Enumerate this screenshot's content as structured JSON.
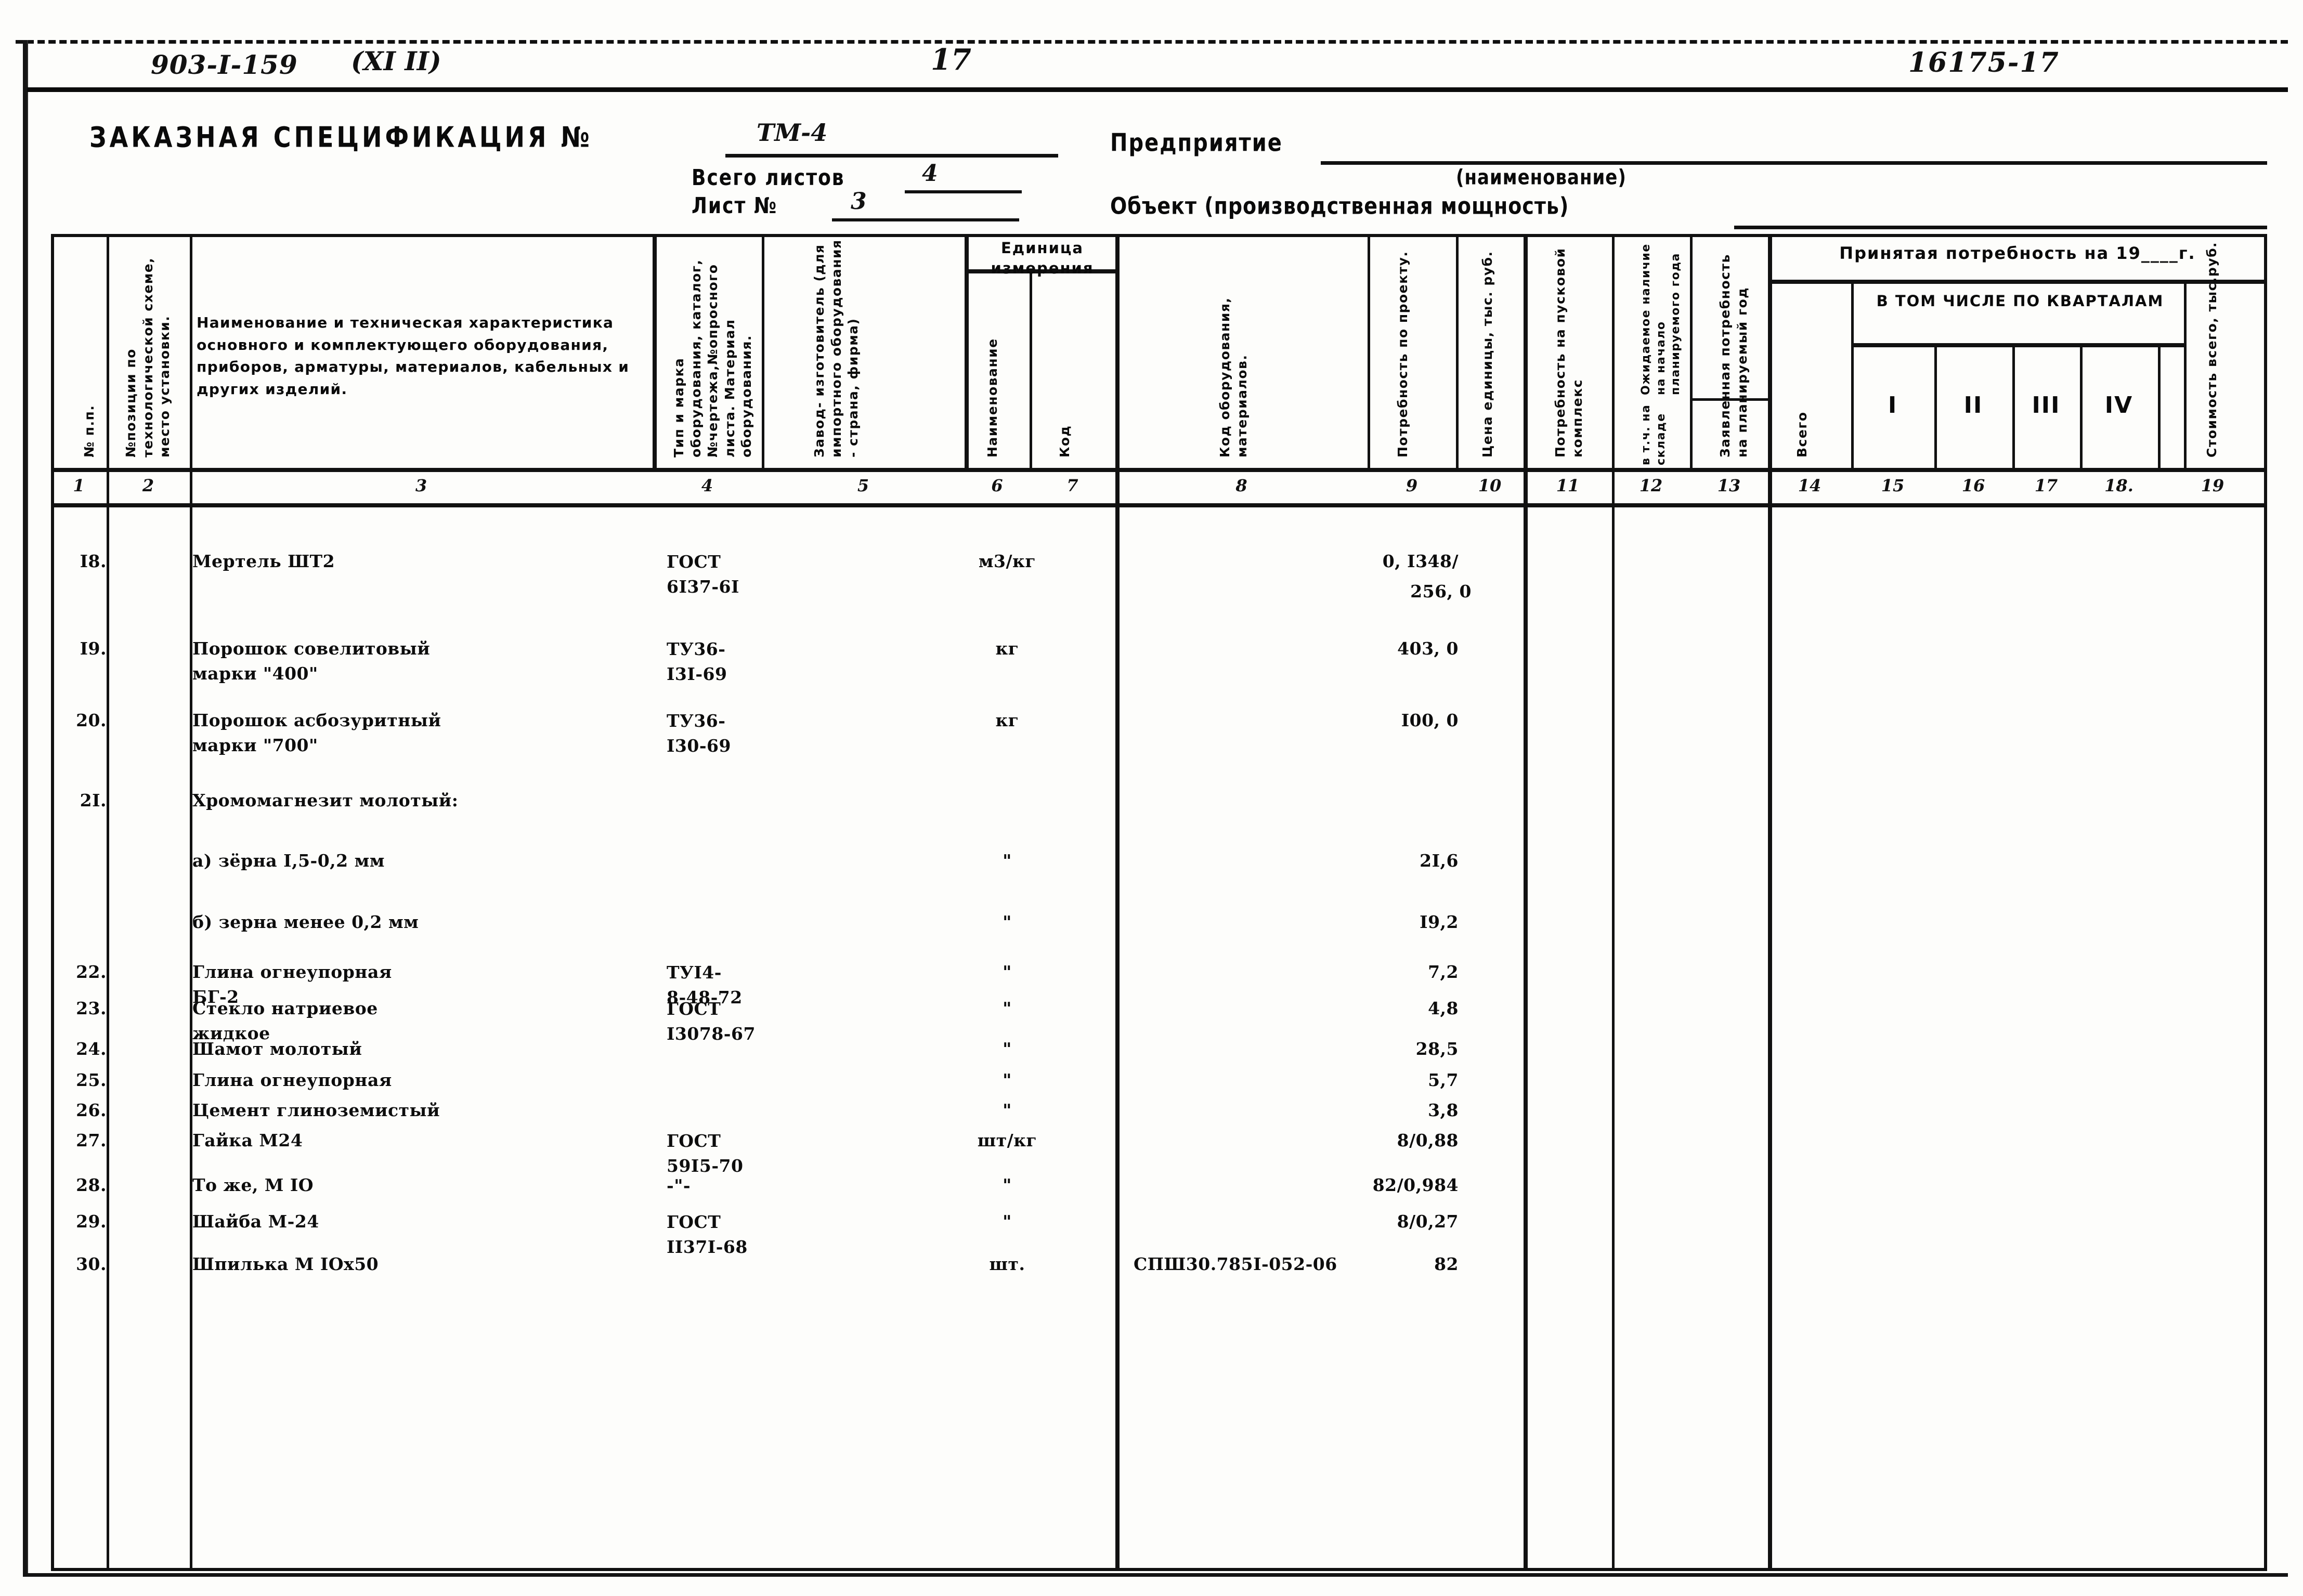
{
  "sheet": {
    "doc_number": "903-I-159",
    "doc_paren": "(XI II)",
    "page_number": "17",
    "archive_number": "16175-17"
  },
  "title": {
    "main": "ЗАКАЗНАЯ СПЕЦИФИКАЦИЯ №",
    "spec_number": "ТМ-4",
    "total_sheets_label": "Всего листов",
    "total_sheets_value": "4",
    "sheet_label": "Лист №",
    "sheet_value": "3",
    "enterprise_label": "Предприятие",
    "enterprise_sub": "(наименование)",
    "object_label": "Объект (производственная мощность)"
  },
  "columns": {
    "c1": "№ п.п.",
    "c2": "№позиции по технологической схеме, место установки.",
    "c3": "Наименование и техническая характеристика основного и комплектующего оборудования, приборов, арматуры, материалов, кабельных и других изделий.",
    "c4": "Тип и марка оборудования, каталог, №чертежа,№опросного листа. Материал оборудования.",
    "c5": "Завод- изготовитель (для импортного оборудования - страна, фирма)",
    "unit_group": "Единица измерения",
    "c6": "Наименование",
    "c7": "Код",
    "c8": "Код оборудования, материалов.",
    "c9": "Потребность по проекту.",
    "c10": "Цена единицы, тыс. руб.",
    "c11": "Потребность на пусковой комплекс",
    "c12": "Ожидаемое наличие на начало планируемого года",
    "c12b": "в т.ч. на складе",
    "c13": "Заявленная потребность на планируемый год",
    "accepted_group": "Принятая потребность на 19____г.",
    "quarters_group": "В ТОМ ЧИСЛЕ ПО КВАРТАЛАМ",
    "c14": "Всего",
    "c15": "I",
    "c16": "II",
    "c17": "III",
    "c18": "IV",
    "c19": "Стоимость всего, тыс.руб.",
    "numbers": [
      "1",
      "2",
      "3",
      "4",
      "5",
      "6",
      "7",
      "8",
      "9",
      "10",
      "11",
      "12",
      "13",
      "14",
      "15",
      "16",
      "17",
      "18.",
      "19"
    ]
  },
  "rows": [
    {
      "no": "I8.",
      "name": "Мертель ШТ2",
      "std1": "ГОСТ",
      "std2": "6I37-6I",
      "unit": "м3/кг",
      "code": "",
      "qty": "0, I348/",
      "qty2": "256, 0"
    },
    {
      "no": "I9.",
      "name": "Порошок совелитовый",
      "name2": "марки \"400\"",
      "std1": "ТУ36-",
      "std2": "I3I-69",
      "unit": "кг",
      "code": "",
      "qty": "403, 0",
      "qty2": ""
    },
    {
      "no": "20.",
      "name": "Порошок асбозуритный",
      "name2": "марки \"700\"",
      "std1": "ТУ36-",
      "std2": "I30-69",
      "unit": "кг",
      "code": "",
      "qty": "I00, 0",
      "qty2": ""
    },
    {
      "no": "2I.",
      "name": "Хромомагнезит молотый:",
      "std1": "",
      "std2": "",
      "unit": "",
      "code": "",
      "qty": "",
      "qty2": ""
    },
    {
      "no": "",
      "name": "а) зёрна I,5-0,2 мм",
      "std1": "",
      "std2": "",
      "unit": "\"",
      "code": "",
      "qty": "2I,6",
      "qty2": ""
    },
    {
      "no": "",
      "name": "б) зерна менее 0,2 мм",
      "std1": "",
      "std2": "",
      "unit": "\"",
      "code": "",
      "qty": "I9,2",
      "qty2": ""
    },
    {
      "no": "22.",
      "name": "Глина огнеупорная",
      "name2": "БГ-2",
      "std1": "ТУI4-",
      "std2": "8-48-72",
      "unit": "\"",
      "code": "",
      "qty": "7,2",
      "qty2": ""
    },
    {
      "no": "23.",
      "name": "Стекло натриевое",
      "name2": "жидкое",
      "std1": "ГОСТ",
      "std2": "I3078-67",
      "unit": "\"",
      "code": "",
      "qty": "4,8",
      "qty2": ""
    },
    {
      "no": "24.",
      "name": "Шамот молотый",
      "std1": "",
      "std2": "",
      "unit": "\"",
      "code": "",
      "qty": "28,5",
      "qty2": ""
    },
    {
      "no": "25.",
      "name": "Глина огнеупорная",
      "std1": "",
      "std2": "",
      "unit": "\"",
      "code": "",
      "qty": "5,7",
      "qty2": ""
    },
    {
      "no": "26.",
      "name": "Цемент глиноземистый",
      "std1": "",
      "std2": "",
      "unit": "\"",
      "code": "",
      "qty": "3,8",
      "qty2": ""
    },
    {
      "no": "27.",
      "name": "Гайка М24",
      "std1": "ГОСТ",
      "std2": "59I5-70",
      "unit": "шт/кг",
      "code": "",
      "qty": "8/0,88",
      "qty2": ""
    },
    {
      "no": "28.",
      "name": "То же, М IO",
      "std1": "-\"-",
      "std2": "",
      "unit": "\"",
      "code": "",
      "qty": "82/0,984",
      "qty2": ""
    },
    {
      "no": "29.",
      "name": "Шайба М-24",
      "std1": "ГОСТ",
      "std2": "II37I-68",
      "unit": "\"",
      "code": "",
      "qty": "8/0,27",
      "qty2": ""
    },
    {
      "no": "30.",
      "name": "Шпилька М IOx50",
      "std1": "",
      "std2": "",
      "unit": "шт.",
      "code": "СПШ30.785I-052-06",
      "qty": "82",
      "qty2": ""
    }
  ]
}
